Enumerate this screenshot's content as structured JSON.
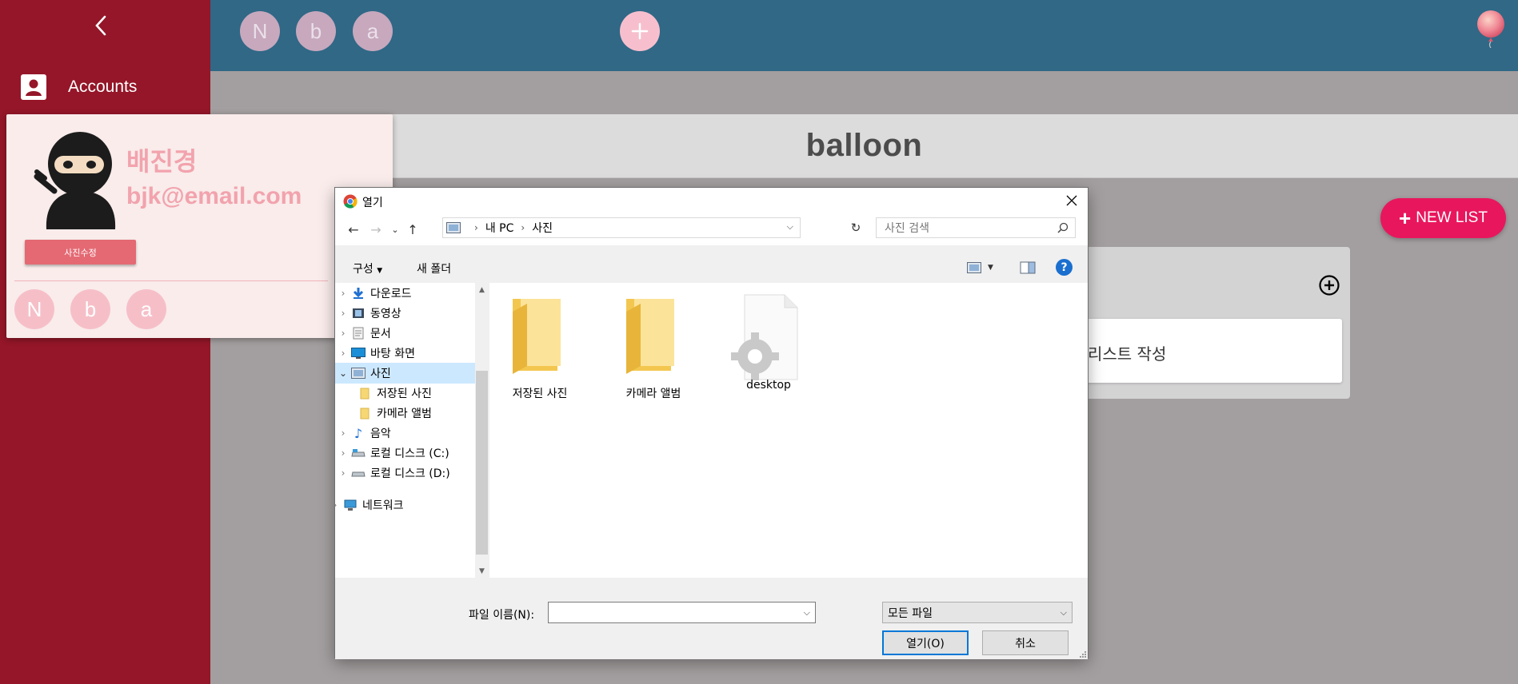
{
  "app": {
    "sidebar": {
      "accounts_label": "Accounts"
    },
    "topbar": {
      "members": [
        "N",
        "b",
        "a"
      ]
    },
    "board_title": "balloon",
    "new_list_label": "NEW LIST",
    "list_card_text": "리스트 작성",
    "colors": {
      "sidebar": "#941628",
      "topbar": "#306886",
      "accent": "#e8175d"
    }
  },
  "profile": {
    "name": "배진경",
    "email": "bjk@email.com",
    "edit_photo_label": "사진수정",
    "members": [
      "N",
      "b",
      "a"
    ]
  },
  "dialog": {
    "title": "열기",
    "address": [
      "내 PC",
      "사진"
    ],
    "search_placeholder": "사진 검색",
    "toolbar": {
      "organize": "구성",
      "new_folder": "새 폴더"
    },
    "tree": [
      {
        "label": "다운로드",
        "icon": "download-icon",
        "expander": "collapsed"
      },
      {
        "label": "동영상",
        "icon": "video-icon",
        "expander": "collapsed"
      },
      {
        "label": "문서",
        "icon": "document-icon",
        "expander": "collapsed"
      },
      {
        "label": "바탕 화면",
        "icon": "desktop-icon",
        "expander": "collapsed"
      },
      {
        "label": "사진",
        "icon": "pictures-icon",
        "expander": "expanded",
        "selected": true
      },
      {
        "label": "저장된 사진",
        "icon": "folder-icon",
        "expander": "none",
        "indent": true
      },
      {
        "label": "카메라 앨범",
        "icon": "folder-icon",
        "expander": "none",
        "indent": true
      },
      {
        "label": "음악",
        "icon": "music-icon",
        "expander": "collapsed"
      },
      {
        "label": "로컬 디스크 (C:)",
        "icon": "drive-icon",
        "expander": "collapsed"
      },
      {
        "label": "로컬 디스크 (D:)",
        "icon": "drive-icon",
        "expander": "collapsed"
      },
      {
        "label": "네트워크",
        "icon": "network-icon",
        "expander": "collapsed",
        "outdent": true
      }
    ],
    "files": [
      {
        "name": "저장된 사진",
        "icon": "folder-icon"
      },
      {
        "name": "카메라 앨범",
        "icon": "folder-icon"
      },
      {
        "name": "desktop",
        "icon": "settings-file-icon"
      }
    ],
    "filename_label": "파일 이름(N):",
    "filename_value": "",
    "filetype_value": "모든 파일",
    "open_label": "열기(O)",
    "cancel_label": "취소"
  }
}
